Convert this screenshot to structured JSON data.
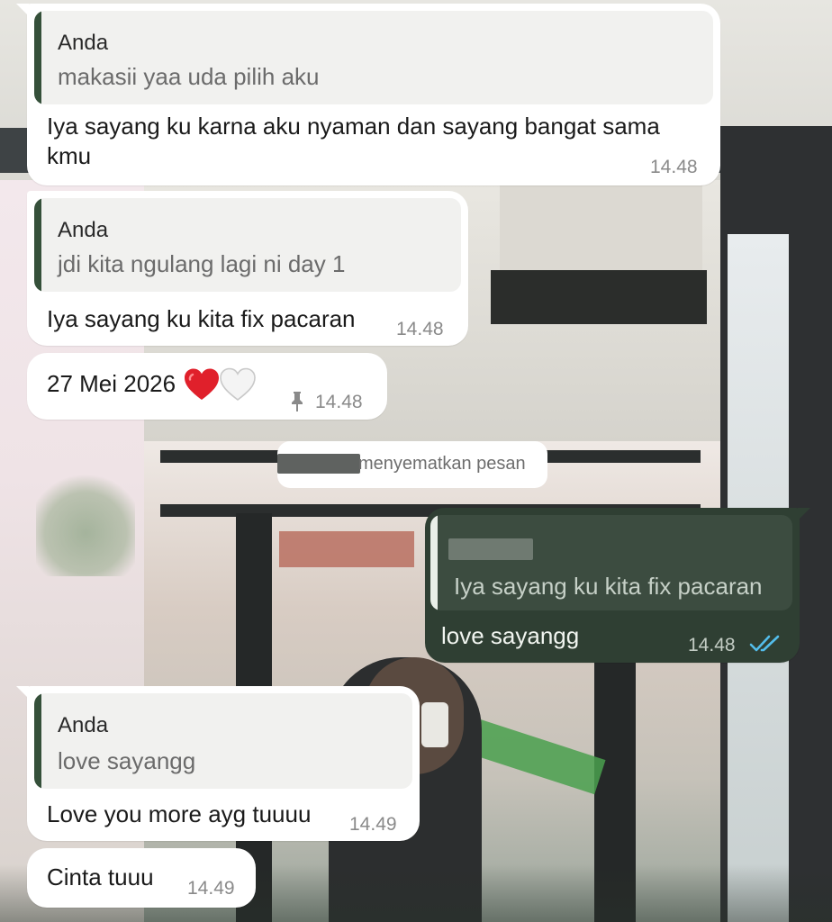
{
  "messages": [
    {
      "id": "m1",
      "direction": "incoming",
      "reply_author": "Anda",
      "reply_text": "makasii yaa uda pilih aku",
      "text": "Iya sayang ku karna aku nyaman dan sayang bangat sama kmu",
      "time": "14.48"
    },
    {
      "id": "m2",
      "direction": "incoming",
      "reply_author": "Anda",
      "reply_text": "jdi kita ngulang lagi ni day 1",
      "text": "Iya sayang ku kita fix pacaran",
      "time": "14.48"
    },
    {
      "id": "m3",
      "direction": "incoming",
      "text": "27 Mei 2026",
      "emojis": [
        "red-heart",
        "white-heart"
      ],
      "pinned": true,
      "time": "14.48"
    },
    {
      "id": "m5",
      "direction": "outgoing",
      "reply_text": "Iya sayang ku kita fix pacaran",
      "text": "love sayangg",
      "time": "14.48",
      "status": "read"
    },
    {
      "id": "m6",
      "direction": "incoming",
      "reply_author": "Anda",
      "reply_text": "love sayangg",
      "text": "Love you more ayg tuuuu",
      "time": "14.49"
    },
    {
      "id": "m7",
      "direction": "incoming",
      "text": "Cinta tuuu",
      "time": "14.49"
    }
  ],
  "system_notice": {
    "text": "menyematkan pesan"
  },
  "colors": {
    "incoming_bubble": "#ffffff",
    "outgoing_bubble": "#2f3f33",
    "quote_bar": "#35503a",
    "read_ticks": "#53bdeb",
    "timestamp": "#8a8a8a"
  },
  "icons": {
    "pin": "pin-icon",
    "read_receipt": "double-check-icon"
  }
}
